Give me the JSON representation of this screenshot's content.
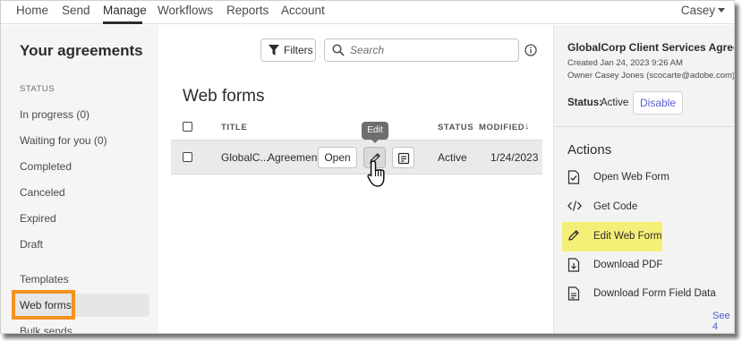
{
  "nav": {
    "items": [
      "Home",
      "Send",
      "Manage",
      "Workflows",
      "Reports",
      "Account"
    ],
    "active": "Manage",
    "user": "Casey"
  },
  "sidebar": {
    "title": "Your agreements",
    "status_label": "STATUS",
    "items": [
      "In progress (0)",
      "Waiting for you (0)",
      "Completed",
      "Canceled",
      "Expired",
      "Draft"
    ],
    "extra_items": [
      "Templates",
      "Web forms",
      "Bulk sends"
    ],
    "selected": "Web forms"
  },
  "toolbar": {
    "filters_label": "Filters",
    "search_placeholder": "Search"
  },
  "main": {
    "title": "Web forms",
    "columns": [
      "TITLE",
      "STATUS",
      "MODIFIED"
    ],
    "row": {
      "title": "GlobalC...",
      "type": "Agreement",
      "open_label": "Open",
      "status": "Active",
      "modified": "1/24/2023"
    },
    "tooltip": "Edit"
  },
  "panel": {
    "title": "GlobalCorp Client Services Agreement",
    "created": "Created Jan 24, 2023 9:26 AM",
    "owner": "Owner Casey Jones (scocarte@adobe.com)",
    "status_label": "Status:",
    "status_value": "Active",
    "disable_label": "Disable",
    "actions_title": "Actions",
    "actions": [
      "Open Web Form",
      "Get Code",
      "Edit Web Form",
      "Download PDF",
      "Download Form Field Data"
    ],
    "see_more": "See 4"
  },
  "colors": {
    "highlight_yellow": "#f4f077",
    "selection_orange": "#f7921e",
    "link_blue": "#4a5ad1"
  }
}
